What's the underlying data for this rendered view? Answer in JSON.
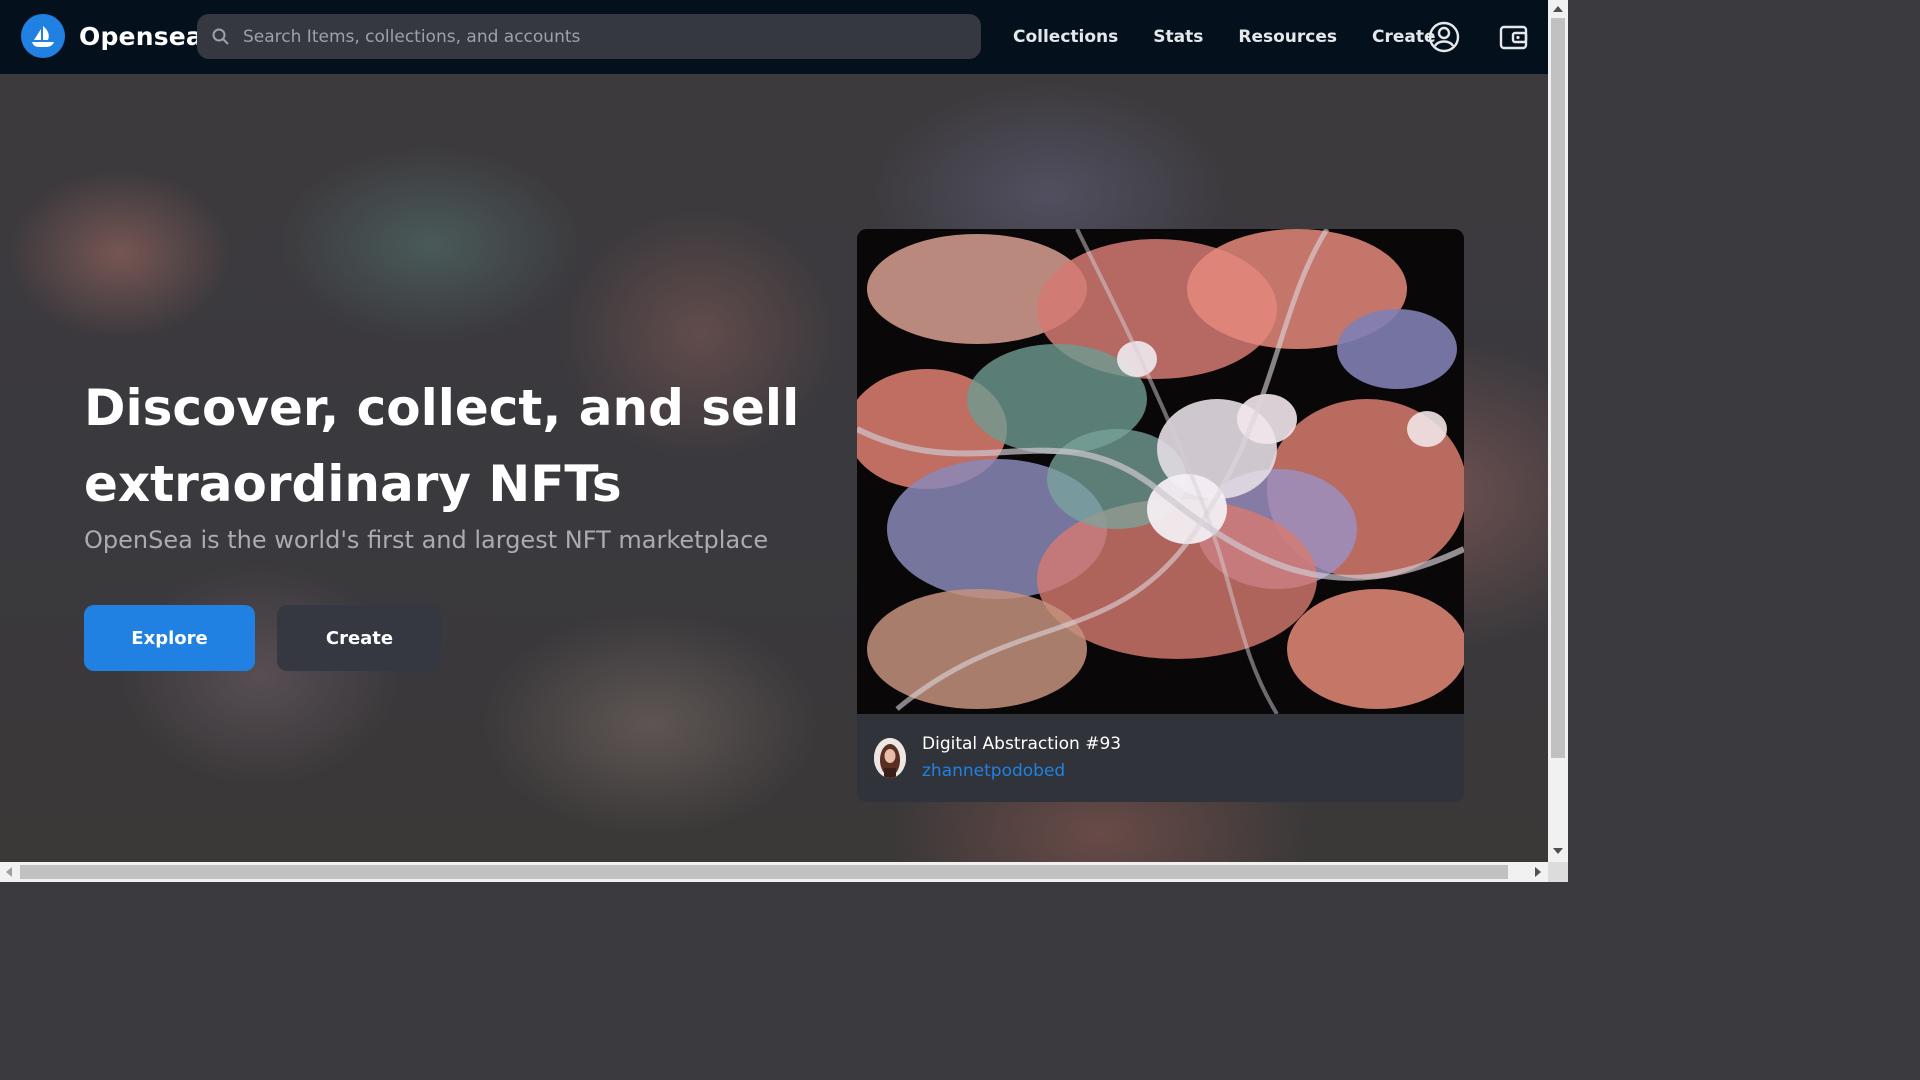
{
  "header": {
    "brand": "Opensea",
    "search_placeholder": "Search Items, collections, and accounts",
    "nav": [
      "Collections",
      "Stats",
      "Resources",
      "Create"
    ],
    "icons": [
      "account-icon",
      "wallet-icon"
    ]
  },
  "hero": {
    "headline": "Discover, collect, and sell extraordinary NFTs",
    "subline": "OpenSea is the world's first and largest NFT marketplace",
    "explore_label": "Explore",
    "create_label": "Create"
  },
  "featured": {
    "title": "Digital Abstraction #93",
    "author": "zhannetpodobed"
  },
  "colors": {
    "nav_bg": "#04111d",
    "accent": "#2081e2",
    "card_bg": "#303339",
    "secondary_button": "#353840"
  }
}
